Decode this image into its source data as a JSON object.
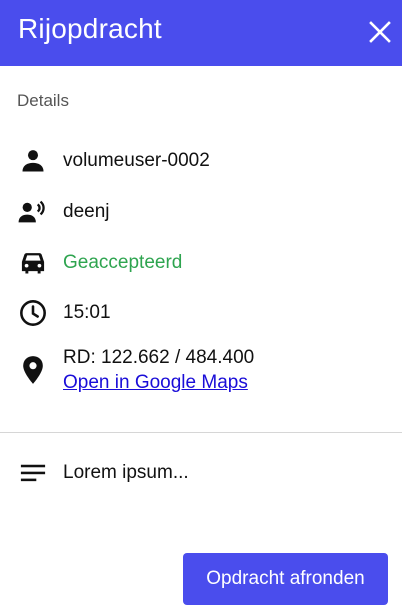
{
  "header": {
    "title": "Rijopdracht",
    "close_icon": "close-icon"
  },
  "details": {
    "label": "Details",
    "user": {
      "icon": "person-icon",
      "value": "volumeuser-0002"
    },
    "speaker": {
      "icon": "speaking-person-icon",
      "value": "deenj"
    },
    "status": {
      "icon": "car-icon",
      "value": "Geaccepteerd",
      "color": "#2ea44f"
    },
    "time": {
      "icon": "clock-icon",
      "value": "15:01"
    },
    "location": {
      "icon": "location-pin-icon",
      "coords": "RD: 122.662 / 484.400",
      "link": "Open in Google Maps"
    }
  },
  "notes": {
    "icon": "notes-icon",
    "text": "Lorem ipsum..."
  },
  "footer": {
    "button_label": "Opdracht afronden"
  },
  "colors": {
    "primary": "#4a4ded",
    "link": "#1a0dd8"
  }
}
